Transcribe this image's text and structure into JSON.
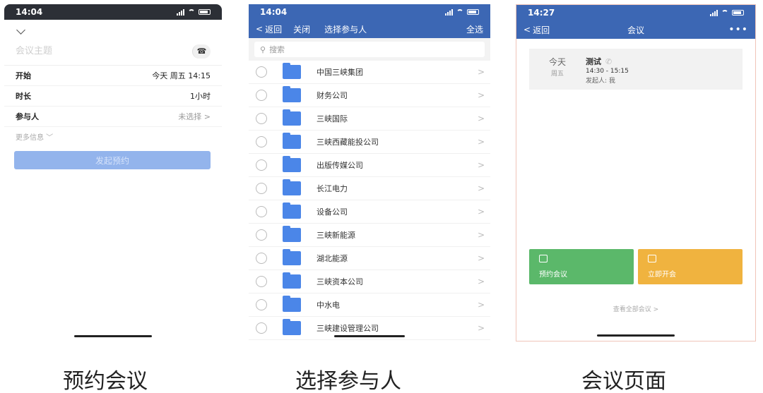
{
  "booking": {
    "time": "14:04",
    "topic_placeholder": "会议主题",
    "start_label": "开始",
    "start_value": "今天 周五 14:15",
    "duration_label": "时长",
    "duration_value": "1小时",
    "participants_label": "参与人",
    "participants_value": "未选择 >",
    "more_info": "更多信息 ﹀",
    "submit_label": "发起预约"
  },
  "select": {
    "time": "14:04",
    "back_label": "返回",
    "close_label": "关闭",
    "title": "选择参与人",
    "select_all": "全选",
    "search_placeholder": "搜索",
    "orgs": [
      "中国三峡集团",
      "财务公司",
      "三峡国际",
      "三峡西藏能投公司",
      "出版传媒公司",
      "长江电力",
      "设备公司",
      "三峡新能源",
      "湖北能源",
      "三峡资本公司",
      "中水电",
      "三峡建设管理公司"
    ]
  },
  "meeting": {
    "time": "14:27",
    "back_label": "返回",
    "title": "会议",
    "card": {
      "today": "今天",
      "weekday": "周五",
      "name": "测试",
      "time_range": "14:30 - 15:15",
      "host": "发起人: 我"
    },
    "book_label": "预约会议",
    "start_label": "立即开会",
    "view_all": "查看全部会议 >"
  },
  "captions": [
    "预约会议",
    "选择参与人",
    "会议页面"
  ]
}
